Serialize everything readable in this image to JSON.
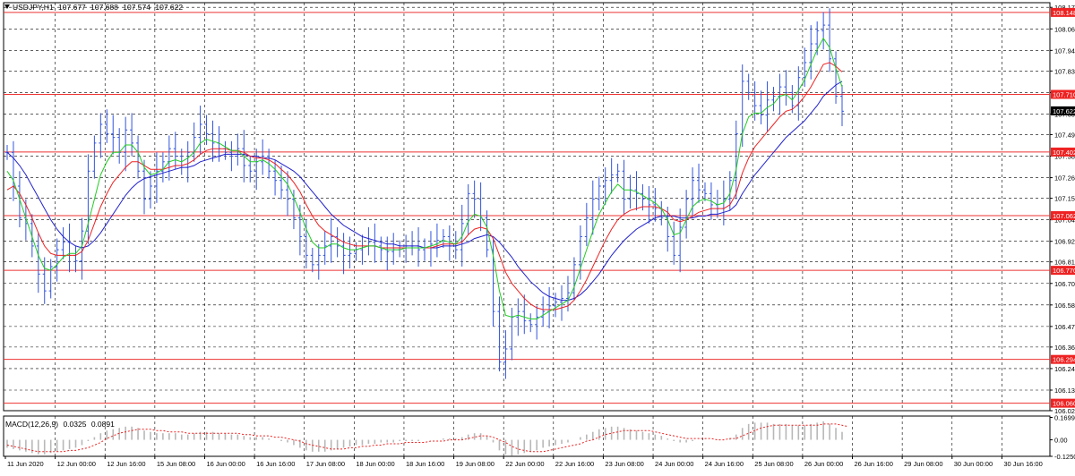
{
  "header": {
    "symbol_label": "USDJPY,H1",
    "open": "107.677",
    "high": "107.688",
    "low": "107.574",
    "close": "107.622"
  },
  "macd_header": {
    "label": "MACD(12,26,9)",
    "main": "0.0325",
    "signal": "0.0891"
  },
  "chart_data": {
    "type": "line",
    "price_axis_ticks": [
      "108.175",
      "108.060",
      "107.945",
      "107.835",
      "107.720",
      "107.605",
      "107.495",
      "107.380",
      "107.265",
      "107.155",
      "107.040",
      "106.925",
      "106.815",
      "106.700",
      "106.585",
      "106.470",
      "106.360",
      "106.245",
      "106.130",
      "106.020"
    ],
    "current_price": "107.622",
    "horizontal_levels": [
      "108.148",
      "107.710",
      "107.402",
      "107.062",
      "106.770",
      "106.294",
      "106.060"
    ],
    "macd_axis_ticks": [
      "0.1699",
      "0.00",
      "-0.1250"
    ],
    "time_labels": [
      "11 Jun 2020",
      "12 Jun 00:00",
      "12 Jun 16:00",
      "15 Jun 08:00",
      "16 Jun 00:00",
      "16 Jun 16:00",
      "17 Jun 08:00",
      "18 Jun 00:00",
      "18 Jun 16:00",
      "19 Jun 08:00",
      "22 Jun 00:00",
      "22 Jun 16:00",
      "23 Jun 08:00",
      "24 Jun 00:00",
      "24 Jun 16:00",
      "25 Jun 08:00",
      "26 Jun 00:00",
      "26 Jun 16:00",
      "29 Jun 08:00",
      "30 Jun 00:00",
      "30 Jun 16:00"
    ],
    "price_ylim": [
      106.02,
      108.2
    ],
    "macd_ylim": [
      -0.125,
      0.18
    ],
    "close_series": [
      107.4,
      107.22,
      107.05,
      107.02,
      106.9,
      106.75,
      106.66,
      106.79,
      106.88,
      106.92,
      106.85,
      106.82,
      106.98,
      107.3,
      107.45,
      107.55,
      107.5,
      107.48,
      107.4,
      107.52,
      107.45,
      107.3,
      107.15,
      107.22,
      107.3,
      107.35,
      107.42,
      107.38,
      107.32,
      107.4,
      107.48,
      107.55,
      107.5,
      107.45,
      107.42,
      107.4,
      107.38,
      107.42,
      107.33,
      107.3,
      107.35,
      107.38,
      107.3,
      107.25,
      107.2,
      107.15,
      107.05,
      106.95,
      106.85,
      106.8,
      106.85,
      106.9,
      106.95,
      106.9,
      106.85,
      106.86,
      106.88,
      106.9,
      106.92,
      106.9,
      106.88,
      106.87,
      106.88,
      106.89,
      106.9,
      106.9,
      106.88,
      106.89,
      106.91,
      106.93,
      106.95,
      106.9,
      106.88,
      107.02,
      107.18,
      107.15,
      107.05,
      106.88,
      106.55,
      106.28,
      106.35,
      106.52,
      106.55,
      106.5,
      106.48,
      106.52,
      106.55,
      106.58,
      106.6,
      106.62,
      106.65,
      106.8,
      106.95,
      107.05,
      107.15,
      107.22,
      107.25,
      107.28,
      107.3,
      107.15,
      107.2,
      107.18,
      107.15,
      107.12,
      107.1,
      107.05,
      106.95,
      106.85,
      107.0,
      107.15,
      107.25,
      107.2,
      107.18,
      107.12,
      107.1,
      107.15,
      107.25,
      107.5,
      107.78,
      107.72,
      107.65,
      107.6,
      107.68,
      107.7,
      107.75,
      107.72,
      107.65,
      107.8,
      107.88,
      107.98,
      108.05,
      108.08,
      107.9,
      107.7,
      107.62
    ],
    "ma_fast": [
      107.3,
      107.25,
      107.15,
      107.05,
      106.95,
      106.85,
      106.78,
      106.77,
      106.8,
      106.84,
      106.86,
      106.86,
      106.9,
      107.02,
      107.15,
      107.28,
      107.35,
      107.4,
      107.4,
      107.44,
      107.44,
      107.4,
      107.32,
      107.28,
      107.29,
      107.31,
      107.35,
      107.36,
      107.35,
      107.37,
      107.4,
      107.45,
      107.47,
      107.46,
      107.45,
      107.43,
      107.41,
      107.41,
      107.38,
      107.35,
      107.35,
      107.36,
      107.34,
      107.31,
      107.27,
      107.23,
      107.16,
      107.08,
      106.99,
      106.92,
      106.89,
      106.89,
      106.91,
      106.91,
      106.89,
      106.88,
      106.88,
      106.89,
      106.9,
      106.9,
      106.89,
      106.88,
      106.88,
      106.88,
      106.89,
      106.89,
      106.89,
      106.89,
      106.9,
      106.91,
      106.93,
      106.92,
      106.91,
      106.95,
      107.03,
      107.07,
      107.06,
      107.0,
      106.85,
      106.66,
      106.53,
      106.52,
      106.53,
      106.52,
      106.51,
      106.51,
      106.53,
      106.55,
      106.57,
      106.59,
      106.61,
      106.68,
      106.78,
      106.88,
      106.98,
      107.07,
      107.13,
      107.19,
      107.23,
      107.2,
      107.2,
      107.19,
      107.17,
      107.15,
      107.13,
      107.1,
      107.04,
      106.96,
      106.97,
      107.04,
      107.11,
      107.14,
      107.15,
      107.14,
      107.12,
      107.13,
      107.18,
      107.31,
      107.5,
      107.59,
      107.61,
      107.61,
      107.64,
      107.66,
      107.7,
      107.71,
      107.68,
      107.73,
      107.79,
      107.87,
      107.95,
      108.01,
      107.96,
      107.85,
      107.75
    ],
    "ma_mid": [
      107.2,
      107.22,
      107.18,
      107.12,
      107.05,
      106.97,
      106.9,
      106.86,
      106.85,
      106.85,
      106.85,
      106.85,
      106.87,
      106.93,
      107.02,
      107.11,
      107.18,
      107.24,
      107.28,
      107.32,
      107.35,
      107.35,
      107.33,
      107.31,
      107.31,
      107.31,
      107.32,
      107.33,
      107.33,
      107.34,
      107.36,
      107.39,
      107.41,
      107.42,
      107.42,
      107.42,
      107.41,
      107.41,
      107.4,
      107.38,
      107.37,
      107.37,
      107.36,
      107.34,
      107.31,
      107.28,
      107.24,
      107.19,
      107.12,
      107.06,
      107.01,
      106.98,
      106.96,
      106.94,
      106.92,
      106.91,
      106.9,
      106.9,
      106.9,
      106.9,
      106.89,
      106.89,
      106.89,
      106.89,
      106.89,
      106.89,
      106.89,
      106.89,
      106.89,
      106.9,
      106.91,
      106.91,
      106.91,
      106.92,
      106.96,
      106.99,
      107.0,
      106.99,
      106.94,
      106.85,
      106.76,
      106.7,
      106.66,
      106.62,
      106.59,
      106.57,
      106.56,
      106.56,
      106.56,
      106.57,
      106.58,
      106.61,
      106.66,
      106.72,
      106.79,
      106.86,
      106.93,
      106.99,
      107.04,
      107.07,
      107.09,
      107.1,
      107.11,
      107.11,
      107.11,
      107.1,
      107.08,
      107.04,
      107.03,
      107.04,
      107.06,
      107.08,
      107.09,
      107.1,
      107.1,
      107.1,
      107.12,
      107.18,
      107.29,
      107.37,
      107.43,
      107.47,
      107.51,
      107.55,
      107.59,
      107.62,
      107.63,
      107.66,
      107.7,
      107.75,
      107.81,
      107.87,
      107.88,
      107.86,
      107.83
    ],
    "ma_slow": [
      107.4,
      107.37,
      107.33,
      107.28,
      107.22,
      107.16,
      107.1,
      107.04,
      106.99,
      106.95,
      106.92,
      106.9,
      106.89,
      106.9,
      106.93,
      106.97,
      107.02,
      107.07,
      107.12,
      107.17,
      107.21,
      107.24,
      107.26,
      107.27,
      107.28,
      107.29,
      107.3,
      107.31,
      107.32,
      107.32,
      107.33,
      107.35,
      107.36,
      107.37,
      107.38,
      107.39,
      107.39,
      107.39,
      107.39,
      107.38,
      107.38,
      107.37,
      107.37,
      107.36,
      107.34,
      107.32,
      107.3,
      107.27,
      107.23,
      107.19,
      107.15,
      107.11,
      107.07,
      107.04,
      107.01,
      106.99,
      106.97,
      106.95,
      106.94,
      106.93,
      106.92,
      106.91,
      106.91,
      106.9,
      106.9,
      106.9,
      106.9,
      106.89,
      106.89,
      106.89,
      106.9,
      106.9,
      106.9,
      106.91,
      106.92,
      106.94,
      106.95,
      106.96,
      106.95,
      106.92,
      106.88,
      106.84,
      106.79,
      106.75,
      106.71,
      106.68,
      106.65,
      106.63,
      106.62,
      106.61,
      106.61,
      106.62,
      106.64,
      106.67,
      106.71,
      106.75,
      106.8,
      106.85,
      106.89,
      106.93,
      106.96,
      106.99,
      107.01,
      107.03,
      107.05,
      107.06,
      107.06,
      107.06,
      107.05,
      107.05,
      107.05,
      107.06,
      107.06,
      107.07,
      107.07,
      107.08,
      107.09,
      107.12,
      107.18,
      107.23,
      107.28,
      107.32,
      107.36,
      107.4,
      107.44,
      107.48,
      107.51,
      107.54,
      107.57,
      107.61,
      107.65,
      107.7,
      107.73,
      107.76,
      107.78
    ],
    "macd_hist": [
      -0.06,
      -0.07,
      -0.08,
      -0.09,
      -0.1,
      -0.11,
      -0.11,
      -0.1,
      -0.09,
      -0.08,
      -0.07,
      -0.06,
      -0.04,
      -0.01,
      0.02,
      0.05,
      0.07,
      0.08,
      0.09,
      0.1,
      0.1,
      0.09,
      0.07,
      0.06,
      0.05,
      0.05,
      0.05,
      0.05,
      0.04,
      0.04,
      0.05,
      0.06,
      0.06,
      0.06,
      0.05,
      0.05,
      0.04,
      0.04,
      0.03,
      0.02,
      0.02,
      0.02,
      0.01,
      0.0,
      -0.01,
      -0.02,
      -0.04,
      -0.06,
      -0.08,
      -0.09,
      -0.09,
      -0.09,
      -0.08,
      -0.07,
      -0.06,
      -0.05,
      -0.04,
      -0.04,
      -0.03,
      -0.03,
      -0.02,
      -0.02,
      -0.02,
      -0.01,
      -0.01,
      -0.01,
      -0.01,
      0.0,
      0.0,
      0.0,
      0.01,
      0.01,
      0.01,
      0.02,
      0.04,
      0.05,
      0.05,
      0.03,
      -0.02,
      -0.08,
      -0.11,
      -0.12,
      -0.11,
      -0.1,
      -0.09,
      -0.08,
      -0.06,
      -0.05,
      -0.04,
      -0.03,
      -0.02,
      0.0,
      0.02,
      0.04,
      0.06,
      0.08,
      0.09,
      0.1,
      0.1,
      0.09,
      0.08,
      0.07,
      0.06,
      0.05,
      0.04,
      0.03,
      0.01,
      -0.01,
      -0.02,
      -0.02,
      -0.01,
      0.0,
      0.0,
      0.0,
      0.0,
      0.0,
      0.01,
      0.04,
      0.09,
      0.12,
      0.13,
      0.13,
      0.13,
      0.12,
      0.12,
      0.12,
      0.11,
      0.11,
      0.11,
      0.12,
      0.13,
      0.14,
      0.12,
      0.09,
      0.06
    ],
    "macd_signal": [
      -0.04,
      -0.05,
      -0.06,
      -0.07,
      -0.08,
      -0.09,
      -0.09,
      -0.09,
      -0.09,
      -0.09,
      -0.08,
      -0.08,
      -0.07,
      -0.06,
      -0.04,
      -0.02,
      0.01,
      0.03,
      0.05,
      0.06,
      0.07,
      0.08,
      0.08,
      0.08,
      0.07,
      0.07,
      0.06,
      0.06,
      0.06,
      0.05,
      0.05,
      0.05,
      0.05,
      0.05,
      0.05,
      0.05,
      0.05,
      0.05,
      0.04,
      0.04,
      0.03,
      0.03,
      0.03,
      0.02,
      0.02,
      0.01,
      0.0,
      -0.01,
      -0.03,
      -0.04,
      -0.05,
      -0.06,
      -0.07,
      -0.07,
      -0.07,
      -0.06,
      -0.06,
      -0.05,
      -0.05,
      -0.04,
      -0.04,
      -0.03,
      -0.03,
      -0.03,
      -0.02,
      -0.02,
      -0.02,
      -0.02,
      -0.01,
      -0.01,
      -0.01,
      0.0,
      0.0,
      0.0,
      0.01,
      0.02,
      0.03,
      0.03,
      0.02,
      0.0,
      -0.02,
      -0.05,
      -0.07,
      -0.08,
      -0.09,
      -0.09,
      -0.09,
      -0.08,
      -0.07,
      -0.06,
      -0.05,
      -0.04,
      -0.03,
      -0.01,
      0.0,
      0.02,
      0.04,
      0.05,
      0.06,
      0.07,
      0.07,
      0.07,
      0.07,
      0.07,
      0.06,
      0.05,
      0.04,
      0.03,
      0.02,
      0.01,
      0.01,
      0.01,
      0.01,
      0.01,
      0.0,
      0.0,
      0.01,
      0.01,
      0.03,
      0.05,
      0.07,
      0.09,
      0.1,
      0.11,
      0.11,
      0.11,
      0.11,
      0.11,
      0.11,
      0.11,
      0.11,
      0.12,
      0.12,
      0.12,
      0.11,
      0.1
    ],
    "colors": {
      "price": "#3355dd",
      "ma_fast": "#22cc22",
      "ma_mid": "#ee2222",
      "ma_slow": "#2222cc",
      "level_line": "#ee3333",
      "macd_hist": "#b8b8b8",
      "macd_signal": "#ee2222",
      "grid": "#000000"
    }
  }
}
